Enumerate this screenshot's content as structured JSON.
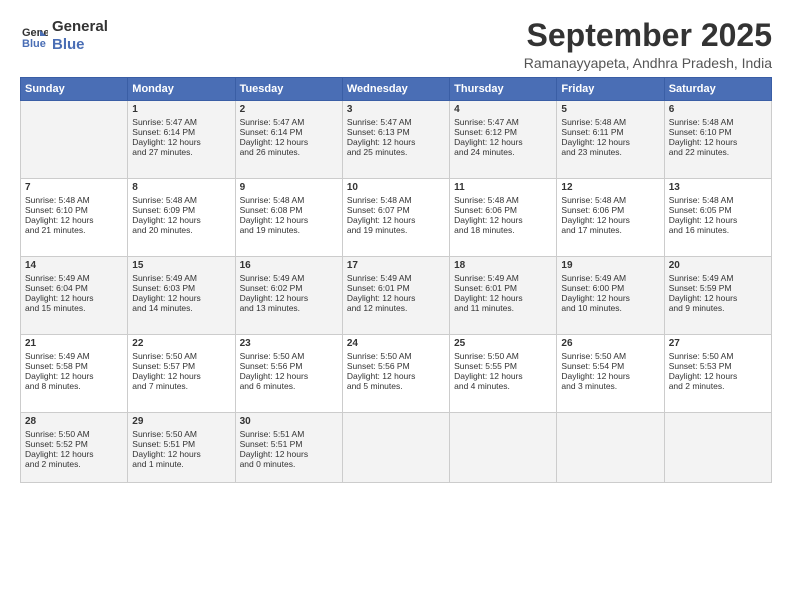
{
  "header": {
    "logo_line1": "General",
    "logo_line2": "Blue",
    "month": "September 2025",
    "location": "Ramanayyapeta, Andhra Pradesh, India"
  },
  "weekdays": [
    "Sunday",
    "Monday",
    "Tuesday",
    "Wednesday",
    "Thursday",
    "Friday",
    "Saturday"
  ],
  "weeks": [
    [
      {
        "day": "",
        "lines": []
      },
      {
        "day": "1",
        "lines": [
          "Sunrise: 5:47 AM",
          "Sunset: 6:14 PM",
          "Daylight: 12 hours",
          "and 27 minutes."
        ]
      },
      {
        "day": "2",
        "lines": [
          "Sunrise: 5:47 AM",
          "Sunset: 6:14 PM",
          "Daylight: 12 hours",
          "and 26 minutes."
        ]
      },
      {
        "day": "3",
        "lines": [
          "Sunrise: 5:47 AM",
          "Sunset: 6:13 PM",
          "Daylight: 12 hours",
          "and 25 minutes."
        ]
      },
      {
        "day": "4",
        "lines": [
          "Sunrise: 5:47 AM",
          "Sunset: 6:12 PM",
          "Daylight: 12 hours",
          "and 24 minutes."
        ]
      },
      {
        "day": "5",
        "lines": [
          "Sunrise: 5:48 AM",
          "Sunset: 6:11 PM",
          "Daylight: 12 hours",
          "and 23 minutes."
        ]
      },
      {
        "day": "6",
        "lines": [
          "Sunrise: 5:48 AM",
          "Sunset: 6:10 PM",
          "Daylight: 12 hours",
          "and 22 minutes."
        ]
      }
    ],
    [
      {
        "day": "7",
        "lines": [
          "Sunrise: 5:48 AM",
          "Sunset: 6:10 PM",
          "Daylight: 12 hours",
          "and 21 minutes."
        ]
      },
      {
        "day": "8",
        "lines": [
          "Sunrise: 5:48 AM",
          "Sunset: 6:09 PM",
          "Daylight: 12 hours",
          "and 20 minutes."
        ]
      },
      {
        "day": "9",
        "lines": [
          "Sunrise: 5:48 AM",
          "Sunset: 6:08 PM",
          "Daylight: 12 hours",
          "and 19 minutes."
        ]
      },
      {
        "day": "10",
        "lines": [
          "Sunrise: 5:48 AM",
          "Sunset: 6:07 PM",
          "Daylight: 12 hours",
          "and 19 minutes."
        ]
      },
      {
        "day": "11",
        "lines": [
          "Sunrise: 5:48 AM",
          "Sunset: 6:06 PM",
          "Daylight: 12 hours",
          "and 18 minutes."
        ]
      },
      {
        "day": "12",
        "lines": [
          "Sunrise: 5:48 AM",
          "Sunset: 6:06 PM",
          "Daylight: 12 hours",
          "and 17 minutes."
        ]
      },
      {
        "day": "13",
        "lines": [
          "Sunrise: 5:48 AM",
          "Sunset: 6:05 PM",
          "Daylight: 12 hours",
          "and 16 minutes."
        ]
      }
    ],
    [
      {
        "day": "14",
        "lines": [
          "Sunrise: 5:49 AM",
          "Sunset: 6:04 PM",
          "Daylight: 12 hours",
          "and 15 minutes."
        ]
      },
      {
        "day": "15",
        "lines": [
          "Sunrise: 5:49 AM",
          "Sunset: 6:03 PM",
          "Daylight: 12 hours",
          "and 14 minutes."
        ]
      },
      {
        "day": "16",
        "lines": [
          "Sunrise: 5:49 AM",
          "Sunset: 6:02 PM",
          "Daylight: 12 hours",
          "and 13 minutes."
        ]
      },
      {
        "day": "17",
        "lines": [
          "Sunrise: 5:49 AM",
          "Sunset: 6:01 PM",
          "Daylight: 12 hours",
          "and 12 minutes."
        ]
      },
      {
        "day": "18",
        "lines": [
          "Sunrise: 5:49 AM",
          "Sunset: 6:01 PM",
          "Daylight: 12 hours",
          "and 11 minutes."
        ]
      },
      {
        "day": "19",
        "lines": [
          "Sunrise: 5:49 AM",
          "Sunset: 6:00 PM",
          "Daylight: 12 hours",
          "and 10 minutes."
        ]
      },
      {
        "day": "20",
        "lines": [
          "Sunrise: 5:49 AM",
          "Sunset: 5:59 PM",
          "Daylight: 12 hours",
          "and 9 minutes."
        ]
      }
    ],
    [
      {
        "day": "21",
        "lines": [
          "Sunrise: 5:49 AM",
          "Sunset: 5:58 PM",
          "Daylight: 12 hours",
          "and 8 minutes."
        ]
      },
      {
        "day": "22",
        "lines": [
          "Sunrise: 5:50 AM",
          "Sunset: 5:57 PM",
          "Daylight: 12 hours",
          "and 7 minutes."
        ]
      },
      {
        "day": "23",
        "lines": [
          "Sunrise: 5:50 AM",
          "Sunset: 5:56 PM",
          "Daylight: 12 hours",
          "and 6 minutes."
        ]
      },
      {
        "day": "24",
        "lines": [
          "Sunrise: 5:50 AM",
          "Sunset: 5:56 PM",
          "Daylight: 12 hours",
          "and 5 minutes."
        ]
      },
      {
        "day": "25",
        "lines": [
          "Sunrise: 5:50 AM",
          "Sunset: 5:55 PM",
          "Daylight: 12 hours",
          "and 4 minutes."
        ]
      },
      {
        "day": "26",
        "lines": [
          "Sunrise: 5:50 AM",
          "Sunset: 5:54 PM",
          "Daylight: 12 hours",
          "and 3 minutes."
        ]
      },
      {
        "day": "27",
        "lines": [
          "Sunrise: 5:50 AM",
          "Sunset: 5:53 PM",
          "Daylight: 12 hours",
          "and 2 minutes."
        ]
      }
    ],
    [
      {
        "day": "28",
        "lines": [
          "Sunrise: 5:50 AM",
          "Sunset: 5:52 PM",
          "Daylight: 12 hours",
          "and 2 minutes."
        ]
      },
      {
        "day": "29",
        "lines": [
          "Sunrise: 5:50 AM",
          "Sunset: 5:51 PM",
          "Daylight: 12 hours",
          "and 1 minute."
        ]
      },
      {
        "day": "30",
        "lines": [
          "Sunrise: 5:51 AM",
          "Sunset: 5:51 PM",
          "Daylight: 12 hours",
          "and 0 minutes."
        ]
      },
      {
        "day": "",
        "lines": []
      },
      {
        "day": "",
        "lines": []
      },
      {
        "day": "",
        "lines": []
      },
      {
        "day": "",
        "lines": []
      }
    ]
  ]
}
